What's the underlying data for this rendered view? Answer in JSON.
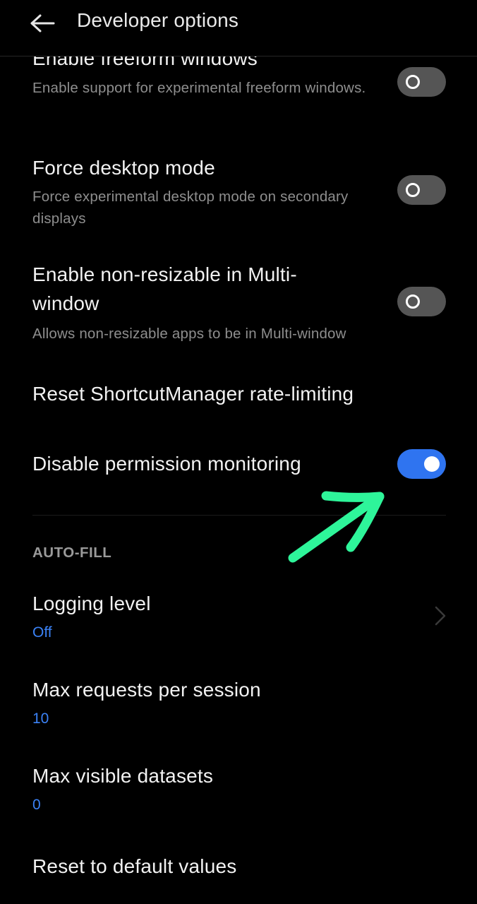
{
  "header": {
    "title": "Developer options",
    "back_icon": "arrow-left-icon"
  },
  "settings": [
    {
      "title": "Enable freeform windows",
      "subtitle": "Enable support for experimental freeform windows.",
      "toggle": "off"
    },
    {
      "title": "Force desktop mode",
      "subtitle": "Force experimental desktop mode on secondary displays",
      "toggle": "off"
    },
    {
      "title": "Enable non-resizable in Multi-window",
      "subtitle": "Allows non-resizable apps to be in Multi-window",
      "toggle": "off"
    },
    {
      "title": "Reset ShortcutManager rate-limiting"
    },
    {
      "title": "Disable permission monitoring",
      "toggle": "on"
    }
  ],
  "autofill": {
    "header": "AUTO-FILL",
    "items": [
      {
        "title": "Logging level",
        "value": "Off",
        "icon": "chevron-right-icon"
      },
      {
        "title": "Max requests per session",
        "value": "10"
      },
      {
        "title": "Max visible datasets",
        "value": "0"
      },
      {
        "title": "Reset to default values"
      }
    ]
  },
  "annotation": {
    "icon": "green-arrow-annotation",
    "color": "#2ef59a"
  },
  "colors": {
    "background": "#000000",
    "accent": "#2f74f0",
    "value_text": "#3b82f6",
    "toggle_off": "#555555"
  }
}
